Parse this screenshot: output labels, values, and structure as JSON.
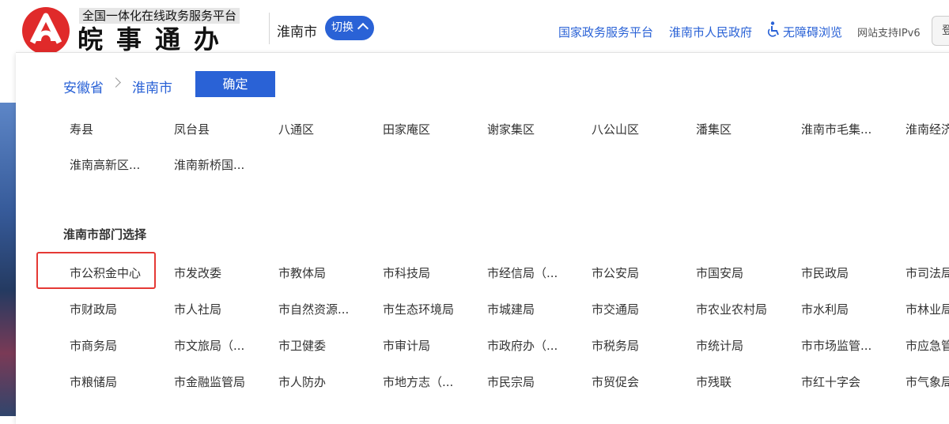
{
  "header": {
    "logo_subtitle": "全国一体化在线政务服务平台",
    "logo_title": "皖事通办",
    "city": "淮南市",
    "switch_label": "切换",
    "links": [
      "国家政务服务平台",
      "淮南市人民政府",
      "无障碍浏览",
      "网站支持IPv6"
    ],
    "login_label": "登",
    "brand_color": "#2a62d6",
    "logo_color": "#e02a2a"
  },
  "selector": {
    "breadcrumb": [
      "安徽省",
      "淮南市"
    ],
    "confirm_label": "确定",
    "regions": [
      "寿县",
      "凤台县",
      "八通区",
      "田家庵区",
      "谢家集区",
      "八公山区",
      "潘集区",
      "淮南市毛集...",
      "淮南经济...",
      "淮南高新区...",
      "淮南新桥国..."
    ],
    "dept_title": "淮南市部门选择",
    "departments": [
      "市公积金中心",
      "市发改委",
      "市教体局",
      "市科技局",
      "市经信局（...",
      "市公安局",
      "市国安局",
      "市民政局",
      "市司法局",
      "市财政局",
      "市人社局",
      "市自然资源...",
      "市生态环境局",
      "市城建局",
      "市交通局",
      "市农业农村局",
      "市水利局",
      "市林业局",
      "市商务局",
      "市文旅局（...",
      "市卫健委",
      "市审计局",
      "市政府办（...",
      "市税务局",
      "市统计局",
      "市市场监管...",
      "市应急管...",
      "市粮储局",
      "市金融监管局",
      "市人防办",
      "市地方志（...",
      "市民宗局",
      "市贸促会",
      "市残联",
      "市红十字会",
      "市气象局"
    ],
    "highlight_color": "#e53935"
  }
}
